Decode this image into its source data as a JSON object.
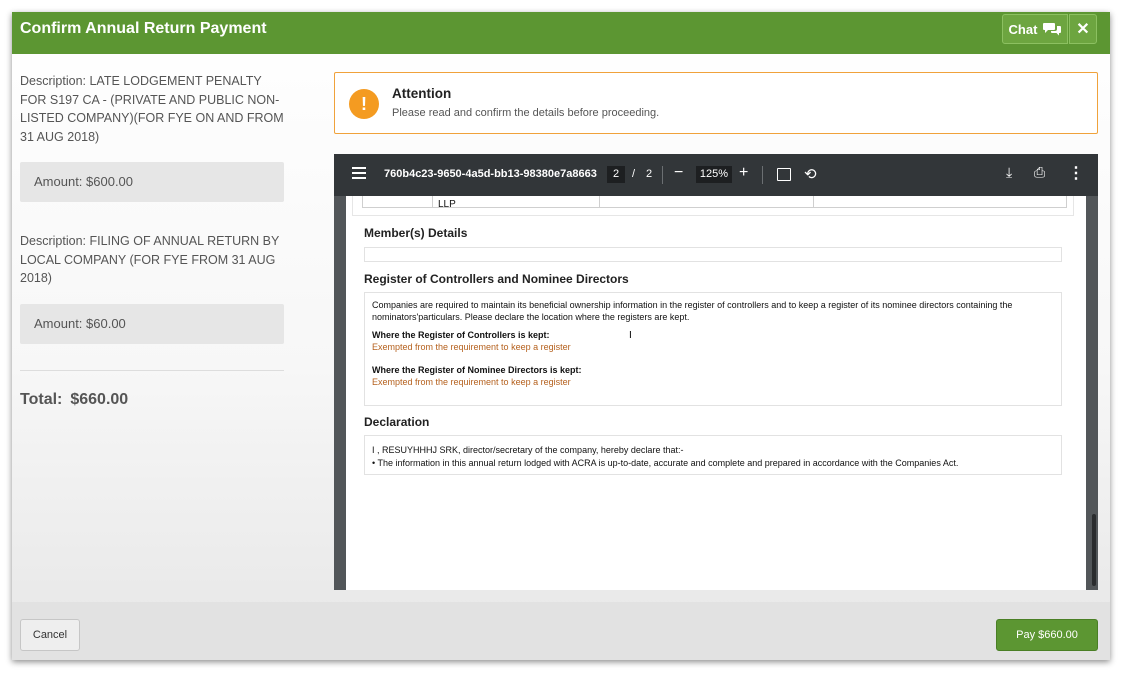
{
  "header": {
    "title": "Confirm Annual Return Payment",
    "chat_label": "Chat",
    "close_glyph": "✕"
  },
  "items": [
    {
      "description": "Description: LATE LODGEMENT PENALTY FOR S197 CA - (PRIVATE AND PUBLIC NON-LISTED COMPANY)(FOR FYE ON AND FROM 31 AUG 2018)",
      "amount": "Amount: $600.00"
    },
    {
      "description": "Description: FILING OF ANNUAL RETURN BY LOCAL COMPANY (FOR FYE FROM 31 AUG 2018)",
      "amount": "Amount: $60.00"
    }
  ],
  "total": {
    "label": "Total:",
    "value": "$660.00"
  },
  "attention": {
    "icon": "!",
    "title": "Attention",
    "message": "Please read and confirm the details before proceeding."
  },
  "pdf": {
    "filename": "760b4c23-9650-4a5d-bb13-98380e7a8663",
    "page_current": "2",
    "page_separator": "/",
    "page_total": "2",
    "zoom": "125%",
    "prev_cell": "LLP",
    "members_title": "Member(s) Details",
    "controllers_title": "Register of Controllers and Nominee Directors",
    "controllers_intro": "Companies are required to maintain its beneficial ownership information in the register of controllers and to keep a register of its nominee directors containing the nominators'particulars. Please declare the location where the registers are kept.",
    "controllers_kept_label": "Where the Register of Controllers is kept:",
    "controllers_kept_value": "Exempted from the requirement to keep a register",
    "nominee_kept_label": "Where the Register of Nominee Directors is kept:",
    "nominee_kept_value": "Exempted from the requirement to keep a register",
    "declaration_title": "Declaration",
    "declaration_line1": "I , RESUYHHHJ SRK, director/secretary of the company, hereby declare that:-",
    "declaration_line2": "• The information in this annual return lodged with ACRA is up-to-date, accurate and complete and prepared in accordance with the Companies Act."
  },
  "footer": {
    "cancel_label": "Cancel",
    "pay_label": "Pay $660.00"
  },
  "colors": {
    "brand_green": "#5c9632",
    "attention_orange": "#f49b21",
    "value_orange": "#b5611e"
  }
}
